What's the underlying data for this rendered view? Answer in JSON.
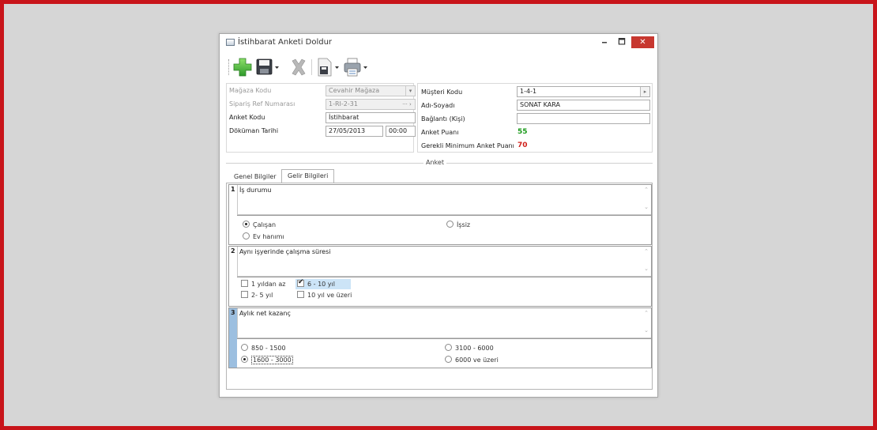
{
  "window": {
    "title": "İstihbarat Anketi Doldur",
    "min_label": "🗕",
    "max_label": "🗖",
    "close_label": "✕"
  },
  "toolbar": {
    "icons": [
      "add-icon",
      "save-icon",
      "delete-icon",
      "document-save-icon",
      "print-icon"
    ],
    "colors": {
      "add": "#3cb043",
      "delete": "#a0a0a0"
    }
  },
  "header_left": {
    "magaza_kodu_label": "Mağaza Kodu",
    "magaza_kodu_value": "Cevahir Mağaza",
    "siparis_label": "Sipariş Ref Numarası",
    "siparis_value": "1-RI-2-31",
    "anket_kodu_label": "Anket Kodu",
    "anket_kodu_value": "İstihbarat",
    "dokuman_tarihi_label": "Döküman Tarihi",
    "dokuman_tarihi_date": "27/05/2013",
    "dokuman_tarihi_time": "00:00"
  },
  "header_right": {
    "musteri_kodu_label": "Müşteri Kodu",
    "musteri_kodu_value": "1-4-1",
    "adi_soyadi_label": "Adı-Soyadı",
    "adi_soyadi_value": "SONAT KARA",
    "baglanti_label": "Bağlantı (Kişi)",
    "baglanti_value": "",
    "anket_puani_label": "Anket Puanı",
    "anket_puani_value": "55",
    "min_puan_label": "Gerekli Minimum Anket Puanı",
    "min_puan_value": "70"
  },
  "group": {
    "title": "Anket"
  },
  "tabs": [
    {
      "label": "Genel Bilgiler",
      "active": false
    },
    {
      "label": "Gelir Bilgileri",
      "active": true
    }
  ],
  "questions": [
    {
      "num": "1",
      "text": "İş durumu",
      "type": "radio",
      "options": [
        {
          "label": "Çalışan",
          "selected": true
        },
        {
          "label": "İşsiz",
          "selected": false
        },
        {
          "label": "Ev hanımı",
          "selected": false
        }
      ]
    },
    {
      "num": "2",
      "text": "Aynı işyerinde çalışma süresi",
      "type": "checkbox",
      "options": [
        {
          "label": "1 yıldan az",
          "checked": false
        },
        {
          "label": "6 - 10 yıl",
          "checked": true
        },
        {
          "label": "2- 5 yıl",
          "checked": false
        },
        {
          "label": "10 yıl ve üzeri",
          "checked": false
        }
      ]
    },
    {
      "num": "3",
      "text": "Aylık net kazanç",
      "type": "radio",
      "options": [
        {
          "label": "850 - 1500",
          "selected": false
        },
        {
          "label": "3100 - 6000",
          "selected": false
        },
        {
          "label": "1600 - 3000",
          "selected": true
        },
        {
          "label": "6000 ve üzeri",
          "selected": false
        }
      ]
    }
  ]
}
